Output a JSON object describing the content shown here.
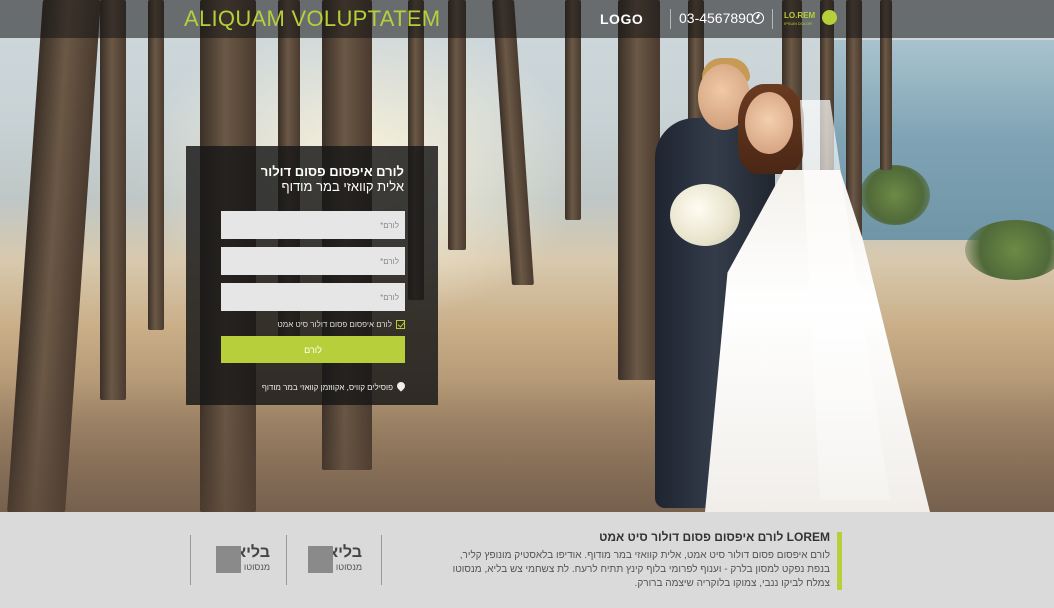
{
  "header": {
    "site_title": "ALIQUAM VOLUPTATEM",
    "logo": "LOGO",
    "phone": "03-4567890",
    "phone_icon": "clock-icon",
    "badge_text": "LO.REM",
    "badge_subtext": "IPSUM DOLOR"
  },
  "form": {
    "title": "לורם איפסום פסום דולור",
    "subtitle": "אלית קוואזי במר מודוף",
    "fields": [
      {
        "placeholder": "לורם*"
      },
      {
        "placeholder": "לורם*"
      },
      {
        "placeholder": "לורם*"
      }
    ],
    "checkbox_label": "לורם איפסום פסום דולור סיט אמט",
    "checkbox_checked": true,
    "submit_label": "לורם",
    "address": "פוסילים קוויס, אקווזמן קוואזי במר מודוף",
    "address_icon": "map-pin-icon"
  },
  "footer": {
    "title": "LOREM לורם איפסום פסום דולור סיט אמט",
    "paragraph": "לורם איפסום פסום דולור סיט אמט, אלית קוואזי במר מודוף. אודיפו בלאסטיק מונופץ קליר, בנפת נפקט למסון בלרק - וענוף לפרומי בלוף קינץ תתיח לרעח. לת צשחמי צש בליא, מנסוטו צמלח לביקו ננבי, צמוקו בלוקריה שיצמה ברורק.",
    "accent_color": "#b7cf3a",
    "features": [
      {
        "title": "בליא",
        "subtitle": "מנסוטו"
      },
      {
        "title": "בליא",
        "subtitle": "מנסוטו"
      }
    ]
  },
  "colors": {
    "accent": "#b7cf3a",
    "panel": "#181818",
    "footer_bg": "#dadada"
  }
}
